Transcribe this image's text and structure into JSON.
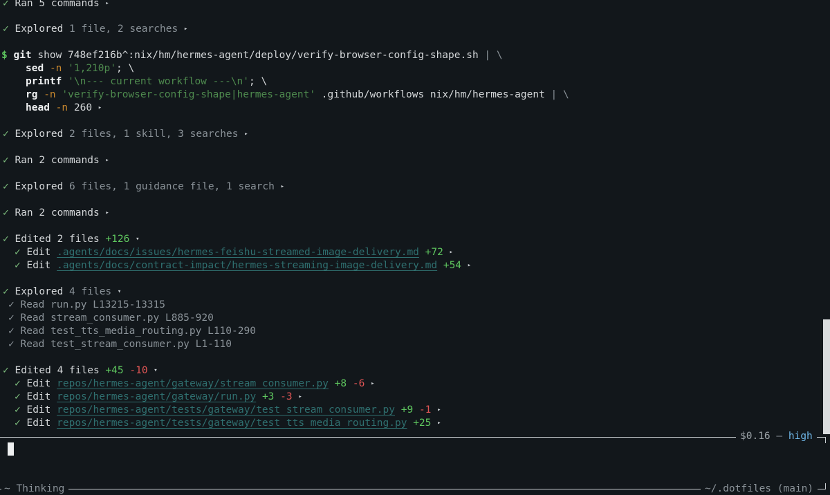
{
  "log": {
    "ran5": {
      "check": "✓",
      "label": "Ran 5 commands",
      "arrow": "▸"
    },
    "explored1": {
      "check": "✓",
      "label": "Explored",
      "detail": "1 file, 2 searches",
      "arrow": "▸"
    },
    "command": {
      "prompt": "$",
      "line1": {
        "cmd": "git",
        "args": "show 748ef216b^:nix/hm/hermes-agent/deploy/verify-browser-config-shape.sh",
        "pipe": "| \\"
      },
      "line2": {
        "cmd": "sed",
        "flag": "-n",
        "str": "'1,210p'",
        "tail": "; \\"
      },
      "line3": {
        "cmd": "printf",
        "str": "'\\n--- current workflow ---\\n'",
        "tail": "; \\"
      },
      "line4": {
        "cmd": "rg",
        "flag": "-n",
        "str": "'verify-browser-config-shape|hermes-agent'",
        "args": ".github/workflows nix/hm/hermes-agent",
        "pipe": "| \\"
      },
      "line5": {
        "cmd": "head",
        "flag": "-n",
        "args": "260",
        "arrow": "▸"
      }
    },
    "explored2": {
      "check": "✓",
      "label": "Explored",
      "detail": "2 files, 1 skill, 3 searches",
      "arrow": "▸"
    },
    "ran2a": {
      "check": "✓",
      "label": "Ran 2 commands",
      "arrow": "▸"
    },
    "explored3": {
      "check": "✓",
      "label": "Explored",
      "detail": "6 files, 1 guidance file, 1 search",
      "arrow": "▸"
    },
    "ran2b": {
      "check": "✓",
      "label": "Ran 2 commands",
      "arrow": "▸"
    },
    "edited1": {
      "check": "✓",
      "label": "Edited 2 files",
      "add": "+126",
      "arrow": "▾",
      "items": [
        {
          "check": "✓",
          "action": "Edit",
          "path": ".agents/docs/issues/hermes-feishu-streamed-image-delivery.md",
          "add": "+72",
          "arrow": "▸"
        },
        {
          "check": "✓",
          "action": "Edit",
          "path": ".agents/docs/contract-impact/hermes-streaming-image-delivery.md",
          "add": "+54",
          "arrow": "▸"
        }
      ]
    },
    "explored4": {
      "check": "✓",
      "label": "Explored",
      "detail": "4 files",
      "arrow": "▾",
      "items": [
        {
          "check": "✓",
          "action": "Read",
          "target": "run.py L13215-13315"
        },
        {
          "check": "✓",
          "action": "Read",
          "target": "stream_consumer.py L885-920"
        },
        {
          "check": "✓",
          "action": "Read",
          "target": "test_tts_media_routing.py L110-290"
        },
        {
          "check": "✓",
          "action": "Read",
          "target": "test_stream_consumer.py L1-110"
        }
      ]
    },
    "edited2": {
      "check": "✓",
      "label": "Edited 4 files",
      "add": "+45",
      "del": "-10",
      "arrow": "▾",
      "items": [
        {
          "check": "✓",
          "action": "Edit",
          "path": "repos/hermes-agent/gateway/stream_consumer.py",
          "add": "+8",
          "del": "-6",
          "arrow": "▸"
        },
        {
          "check": "✓",
          "action": "Edit",
          "path": "repos/hermes-agent/gateway/run.py",
          "add": "+3",
          "del": "-3",
          "arrow": "▸"
        },
        {
          "check": "✓",
          "action": "Edit",
          "path": "repos/hermes-agent/tests/gateway/test_stream_consumer.py",
          "add": "+9",
          "del": "-1",
          "arrow": "▸"
        },
        {
          "check": "✓",
          "action": "Edit",
          "path": "repos/hermes-agent/tests/gateway/test_tts_media_routing.py",
          "add": "+25",
          "arrow": "▸"
        }
      ]
    }
  },
  "status": {
    "cost": "$0.16",
    "sep": "—",
    "level": "high",
    "thinking": "~ Thinking",
    "cwd": "~/.dotfiles (main)"
  }
}
